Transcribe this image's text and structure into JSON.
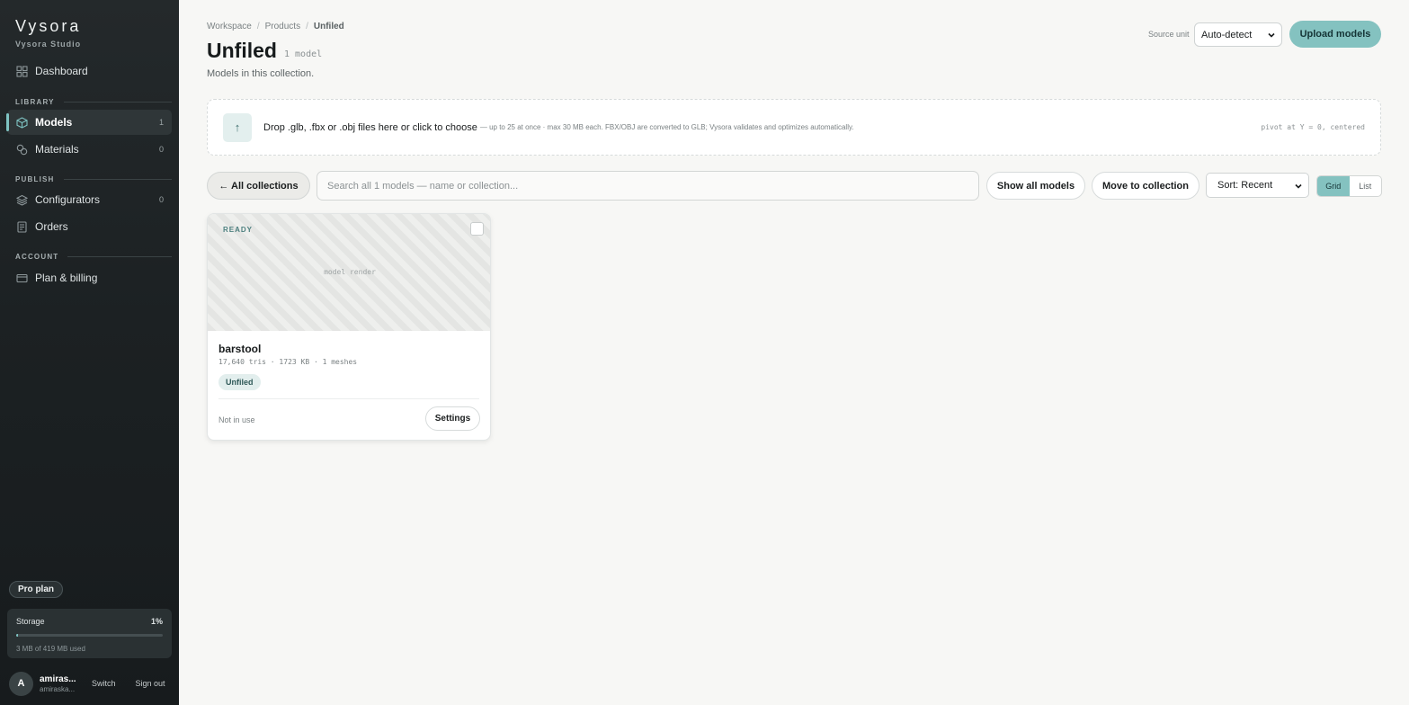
{
  "brand": {
    "name": "Vysora",
    "subtitle": "Vysora Studio"
  },
  "sidebar": {
    "dashboard": {
      "label": "Dashboard",
      "icon": "grid-icon"
    },
    "sections": {
      "library": "LIBRARY",
      "publish": "PUBLISH",
      "account": "ACCOUNT"
    },
    "items": [
      {
        "label": "Models",
        "count": "1",
        "icon": "cube-icon",
        "active": true
      },
      {
        "label": "Materials",
        "count": "0",
        "icon": "materials-icon"
      },
      {
        "label": "Configurators",
        "count": "0",
        "icon": "layers-icon"
      },
      {
        "label": "Orders",
        "icon": "receipt-icon"
      },
      {
        "label": "Plan & billing",
        "icon": "card-icon"
      }
    ],
    "plan": "Pro plan",
    "storage": {
      "label": "Storage",
      "percent": "1%",
      "fill_fraction": 0.01,
      "used": "3 MB of 419 MB used"
    },
    "user": {
      "initial": "A",
      "name": "amiras...",
      "email": "amiraska...",
      "switch": "Switch",
      "sign_out": "Sign out"
    }
  },
  "breadcrumb": {
    "workspace": "Workspace",
    "products": "Products",
    "current": "Unfiled",
    "sep": "/"
  },
  "header": {
    "title": "Unfiled",
    "count": "1 model",
    "description": "Models in this collection.",
    "source_unit_label": "Source unit",
    "source_unit_value": "Auto-detect",
    "upload_label": "Upload models"
  },
  "dropzone": {
    "icon": "↑",
    "main": "Drop .glb, .fbx or .obj files here or click to choose",
    "sub": "— up to 25 at once · max 30 MB each. FBX/OBJ are converted to GLB; Vysora validates and optimizes automatically.",
    "right": "pivot at Y = 0, centered"
  },
  "toolbar": {
    "back_label": "← All collections",
    "search_placeholder": "Search all 1 models — name or collection...",
    "show_all_label": "Show all models",
    "move_label": "Move to collection",
    "sort_value": "Sort: Recent",
    "view_grid": "Grid",
    "view_list": "List"
  },
  "models": [
    {
      "status": "READY",
      "thumb_label": "model render",
      "name": "barstool",
      "meta": "17,640 tris · 1723 KB · 1 meshes",
      "tag": "Unfiled",
      "usage": "Not in use",
      "settings_label": "Settings"
    }
  ],
  "colors": {
    "accent": "#84c2c0",
    "sidebar_bg": "#1c2123",
    "page_bg": "#f7f7f5"
  }
}
